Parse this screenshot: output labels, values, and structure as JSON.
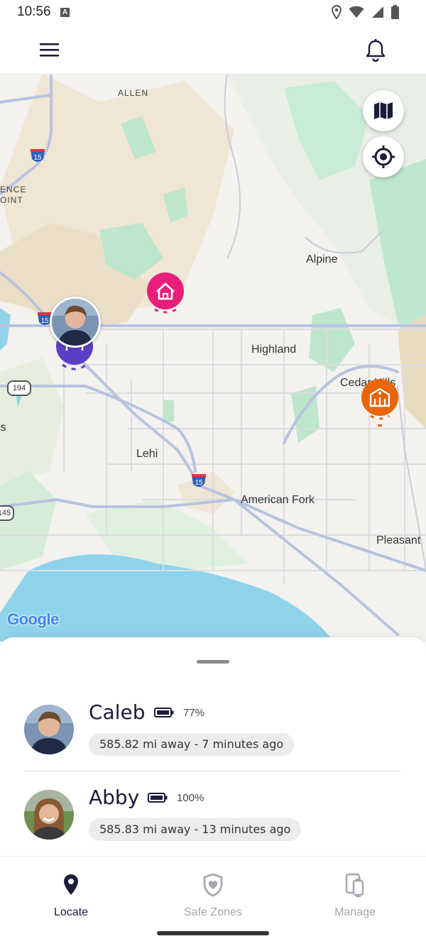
{
  "status_bar": {
    "time": "10:56",
    "notification_icon": "A",
    "icons": [
      "location-icon",
      "wifi-icon",
      "signal-icon",
      "battery-icon"
    ]
  },
  "header": {
    "menu_icon": "hamburger-menu-icon",
    "notifications_icon": "bell-icon"
  },
  "map": {
    "labels": {
      "allen": "ALLEN",
      "ence": "ENCE",
      "oint": "OINT",
      "alpine": "Alpine",
      "highland": "Highland",
      "cedar_hills": "Cedar Hills",
      "lehi": "Lehi",
      "american_fork": "American Fork",
      "pleasant": "Pleasant",
      "ls": "ls"
    },
    "shields": {
      "i15_a": "15",
      "i15_b": "15",
      "i15_c": "15",
      "r194": "194",
      "r145": "145"
    },
    "attribution": "Google",
    "buttons": {
      "map_type_icon": "map-icon",
      "recenter_icon": "crosshair-icon"
    },
    "pins": [
      {
        "type": "home",
        "color": "#e91e7a"
      },
      {
        "type": "school",
        "color": "#e8650a"
      },
      {
        "type": "person",
        "name": "Caleb"
      }
    ],
    "colors": {
      "home_pin": "#e91e7a",
      "school_pin": "#e8650a",
      "device_pin": "#5b3fc4",
      "water": "#8fd3ea",
      "park": "#b9e6c9"
    }
  },
  "people": [
    {
      "name": "Caleb",
      "battery": "77%",
      "status": "585.82 mi away - 7 minutes ago"
    },
    {
      "name": "Abby",
      "battery": "100%",
      "status": "585.83 mi away - 13 minutes ago"
    }
  ],
  "nav": {
    "items": [
      {
        "label": "Locate",
        "icon": "location-pin-icon",
        "active": true
      },
      {
        "label": "Safe Zones",
        "icon": "shield-heart-icon",
        "active": false
      },
      {
        "label": "Manage",
        "icon": "devices-icon",
        "active": false
      }
    ],
    "active_color": "#1b1b3a",
    "inactive_color": "#a5a5ad"
  }
}
